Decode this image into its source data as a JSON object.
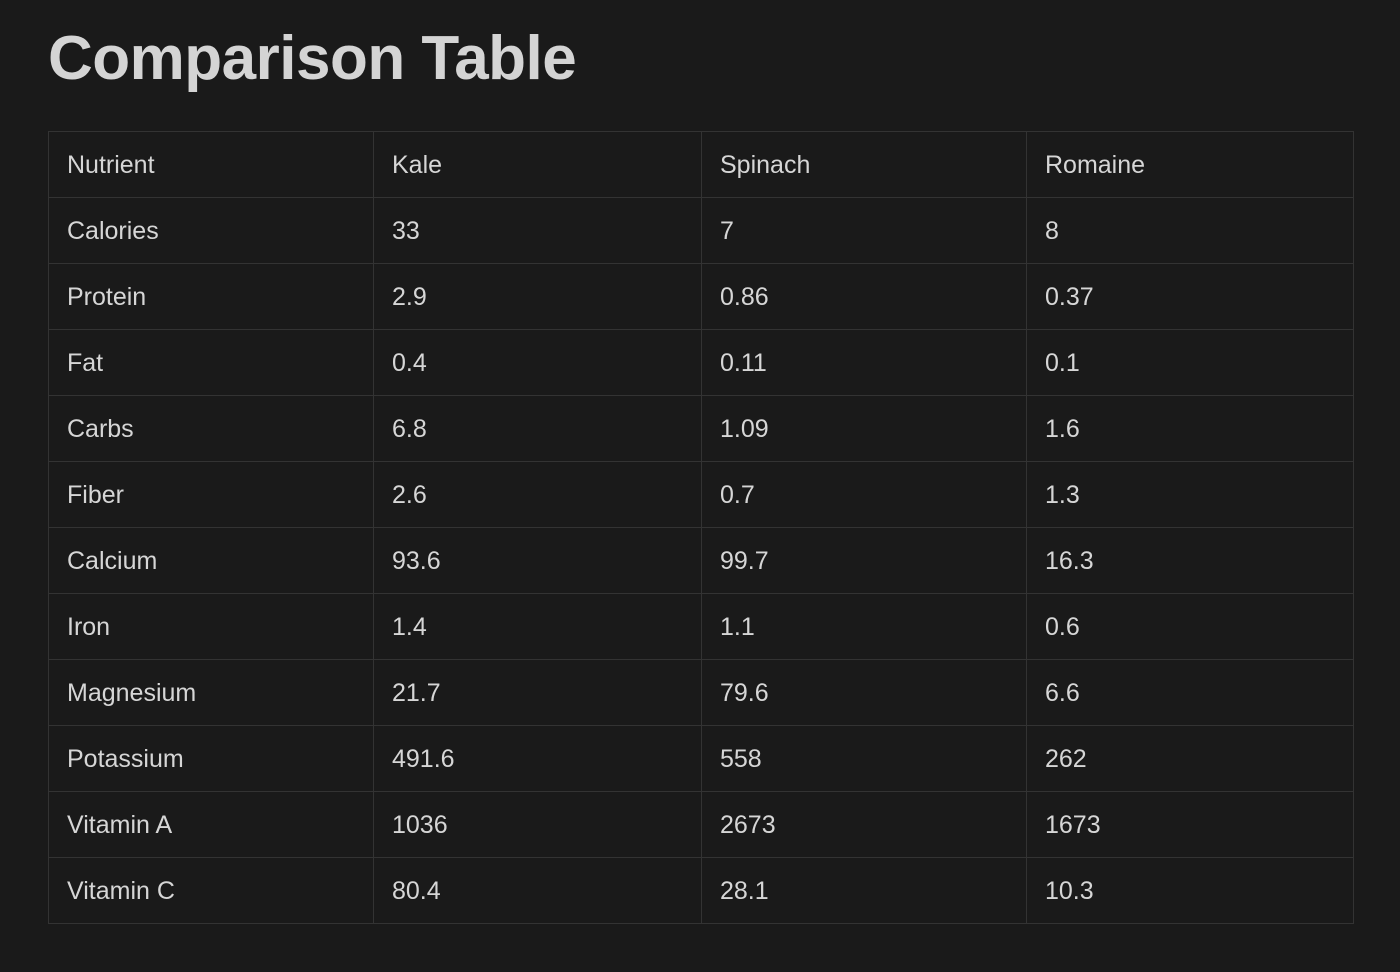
{
  "page": {
    "title": "Comparison Table",
    "background_color": "#1a1a1a",
    "text_color": "#d6d6d6",
    "border_color": "#333333"
  },
  "chart_data": {
    "type": "table",
    "title": "Comparison Table",
    "columns": [
      "Nutrient",
      "Kale",
      "Spinach",
      "Romaine"
    ],
    "categories": [
      "Calories",
      "Protein",
      "Fat",
      "Carbs",
      "Fiber",
      "Calcium",
      "Iron",
      "Magnesium",
      "Potassium",
      "Vitamin A",
      "Vitamin C"
    ],
    "series": [
      {
        "name": "Kale",
        "values": [
          33,
          2.9,
          0.4,
          6.8,
          2.6,
          93.6,
          1.4,
          21.7,
          491.6,
          1036,
          80.4
        ]
      },
      {
        "name": "Spinach",
        "values": [
          7,
          0.86,
          0.11,
          1.09,
          0.7,
          99.7,
          1.1,
          79.6,
          558,
          2673,
          28.1
        ]
      },
      {
        "name": "Romaine",
        "values": [
          8,
          0.37,
          0.1,
          1.6,
          1.3,
          16.3,
          0.6,
          6.6,
          262,
          1673,
          10.3
        ]
      }
    ],
    "rows": [
      [
        "Calories",
        "33",
        "7",
        "8"
      ],
      [
        "Protein",
        "2.9",
        "0.86",
        "0.37"
      ],
      [
        "Fat",
        "0.4",
        "0.11",
        "0.1"
      ],
      [
        "Carbs",
        "6.8",
        "1.09",
        "1.6"
      ],
      [
        "Fiber",
        "2.6",
        "0.7",
        "1.3"
      ],
      [
        "Calcium",
        "93.6",
        "99.7",
        "16.3"
      ],
      [
        "Iron",
        "1.4",
        "1.1",
        "0.6"
      ],
      [
        "Magnesium",
        "21.7",
        "79.6",
        "6.6"
      ],
      [
        "Potassium",
        "491.6",
        "558",
        "262"
      ],
      [
        "Vitamin A",
        "1036",
        "2673",
        "1673"
      ],
      [
        "Vitamin C",
        "80.4",
        "28.1",
        "10.3"
      ]
    ]
  }
}
